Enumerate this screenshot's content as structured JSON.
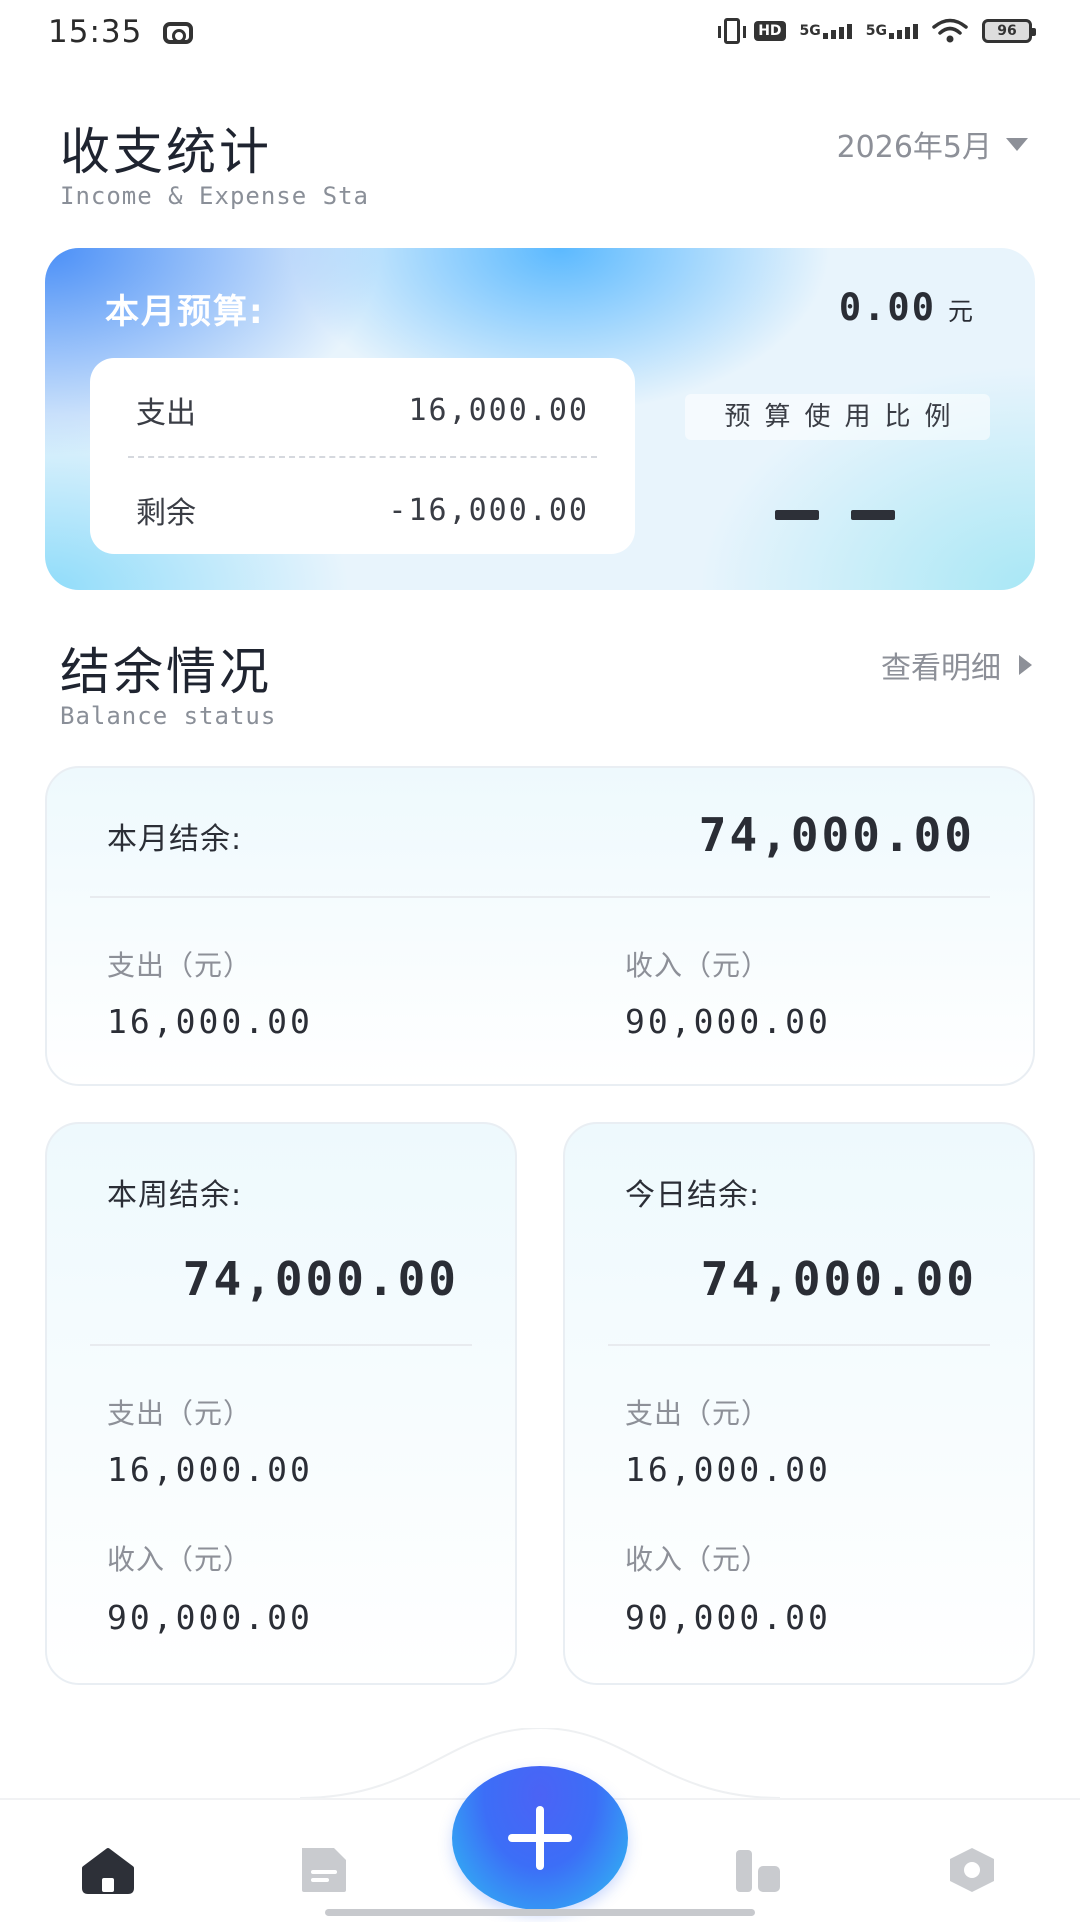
{
  "status_bar": {
    "time": "15:35",
    "hd_badge": "HD",
    "sim1": "5G",
    "sim2": "5G",
    "battery": "96"
  },
  "header": {
    "title": "收支统计",
    "subtitle": "Income & Expense Sta",
    "month": "2026年5月"
  },
  "budget": {
    "label": "本月预算:",
    "amount": "0.00",
    "unit": "元",
    "expense_label": "支出",
    "expense_value": "16,000.00",
    "remaining_label": "剩余",
    "remaining_value": "-16,000.00",
    "ratio_label": "预算使用比例",
    "ratio_value": "--"
  },
  "balance": {
    "title": "结余情况",
    "subtitle": "Balance status",
    "details_link": "查看明细",
    "month": {
      "label": "本月结余:",
      "amount": "74,000.00",
      "expense_label": "支出（元）",
      "expense": "16,000.00",
      "income_label": "收入（元）",
      "income": "90,000.00"
    },
    "week": {
      "label": "本周结余:",
      "amount": "74,000.00",
      "expense_label": "支出（元）",
      "expense": "16,000.00",
      "income_label": "收入（元）",
      "income": "90,000.00"
    },
    "today": {
      "label": "今日结余:",
      "amount": "74,000.00",
      "expense_label": "支出（元）",
      "expense": "16,000.00",
      "income_label": "收入（元）",
      "income": "90,000.00"
    }
  },
  "nav": {
    "items": [
      "home-icon",
      "bill-icon",
      "add-icon",
      "chart-icon",
      "settings-icon"
    ],
    "active": "home-icon",
    "colors": {
      "active": "#2d3038",
      "inactive": "#c9cbcf",
      "fab_start": "#4b63f5",
      "fab_end": "#2fc0f2"
    }
  }
}
